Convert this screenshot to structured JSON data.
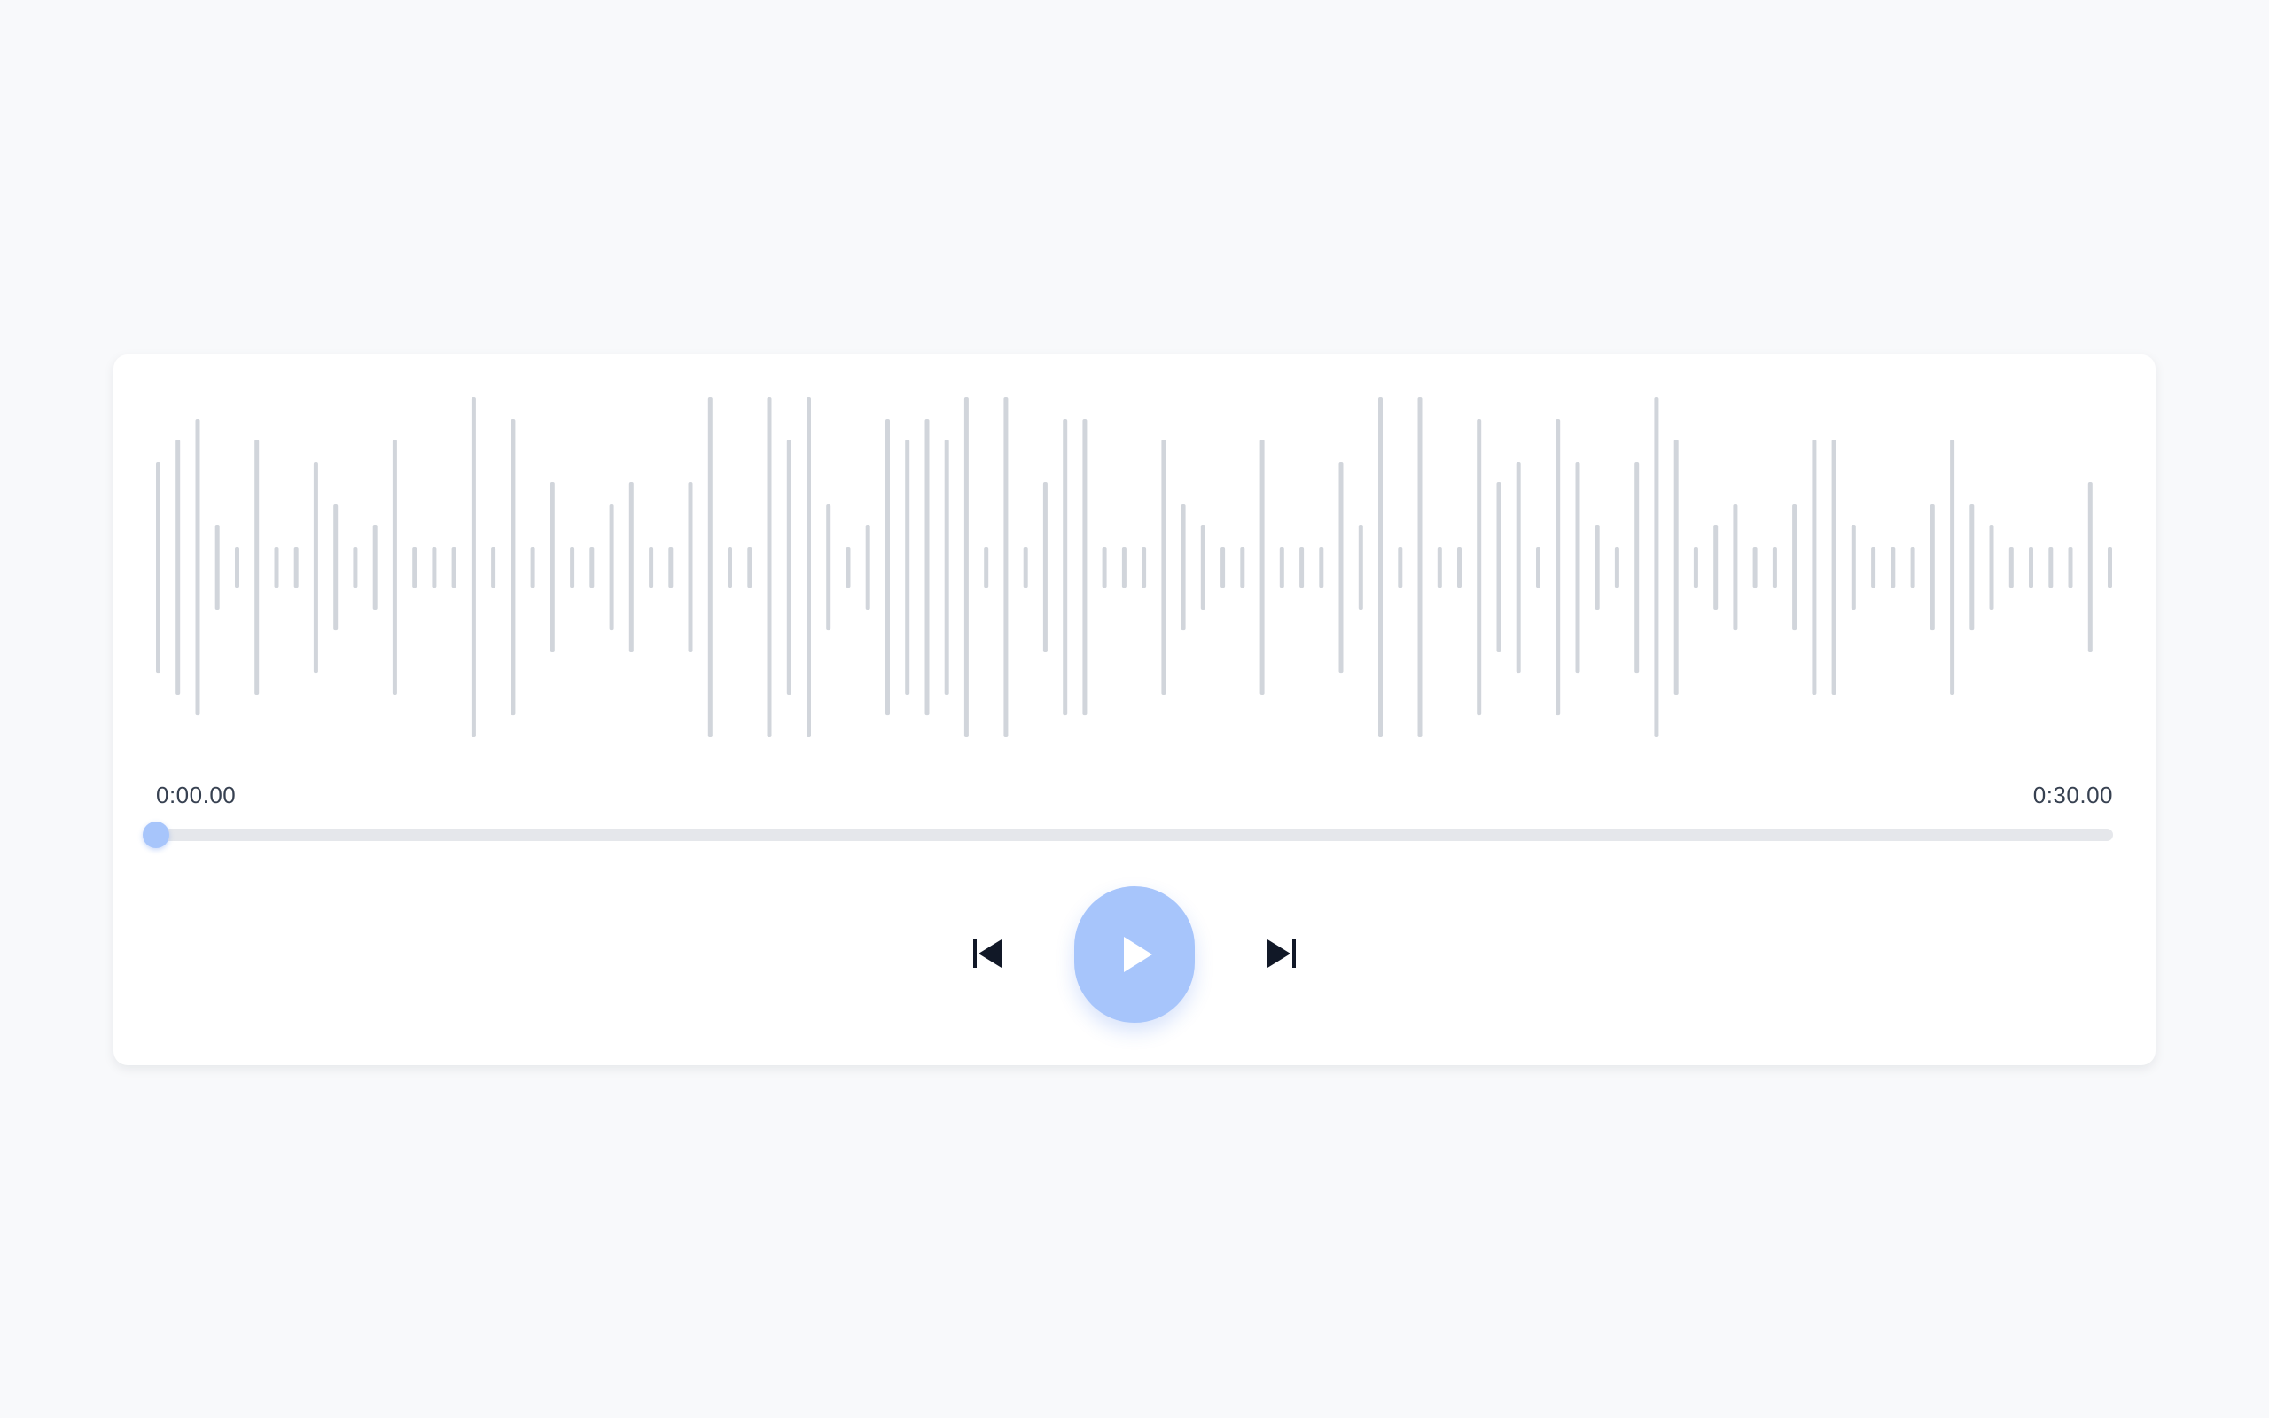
{
  "player": {
    "current_time": "0:00.00",
    "duration": "0:30.00",
    "progress": 0,
    "accent_color": "#a7c5fb",
    "waveform_color": "#d1d5db",
    "waveform_levels": [
      0.62,
      0.75,
      0.87,
      0.25,
      0.12,
      0.75,
      0.12,
      0.12,
      0.62,
      0.37,
      0.12,
      0.25,
      0.75,
      0.12,
      0.12,
      0.12,
      1.0,
      0.12,
      0.87,
      0.12,
      0.5,
      0.12,
      0.12,
      0.37,
      0.5,
      0.12,
      0.12,
      0.5,
      1.0,
      0.12,
      0.12,
      1.0,
      0.75,
      1.0,
      0.37,
      0.12,
      0.25,
      0.87,
      0.75,
      0.87,
      0.75,
      1.0,
      0.12,
      1.0,
      0.12,
      0.5,
      0.87,
      0.87,
      0.12,
      0.12,
      0.12,
      0.75,
      0.37,
      0.25,
      0.12,
      0.12,
      0.75,
      0.12,
      0.12,
      0.12,
      0.62,
      0.25,
      1.0,
      0.12,
      1.0,
      0.12,
      0.12,
      0.87,
      0.5,
      0.62,
      0.12,
      0.87,
      0.62,
      0.25,
      0.12,
      0.62,
      1.0,
      0.75,
      0.12,
      0.25,
      0.37,
      0.12,
      0.12,
      0.37,
      0.75,
      0.75,
      0.25,
      0.12,
      0.12,
      0.12,
      0.37,
      0.75,
      0.37,
      0.25,
      0.12,
      0.12,
      0.12,
      0.12,
      0.5,
      0.12
    ],
    "icons": {
      "previous": "skip-previous-icon",
      "play": "play-icon",
      "next": "skip-next-icon"
    }
  }
}
